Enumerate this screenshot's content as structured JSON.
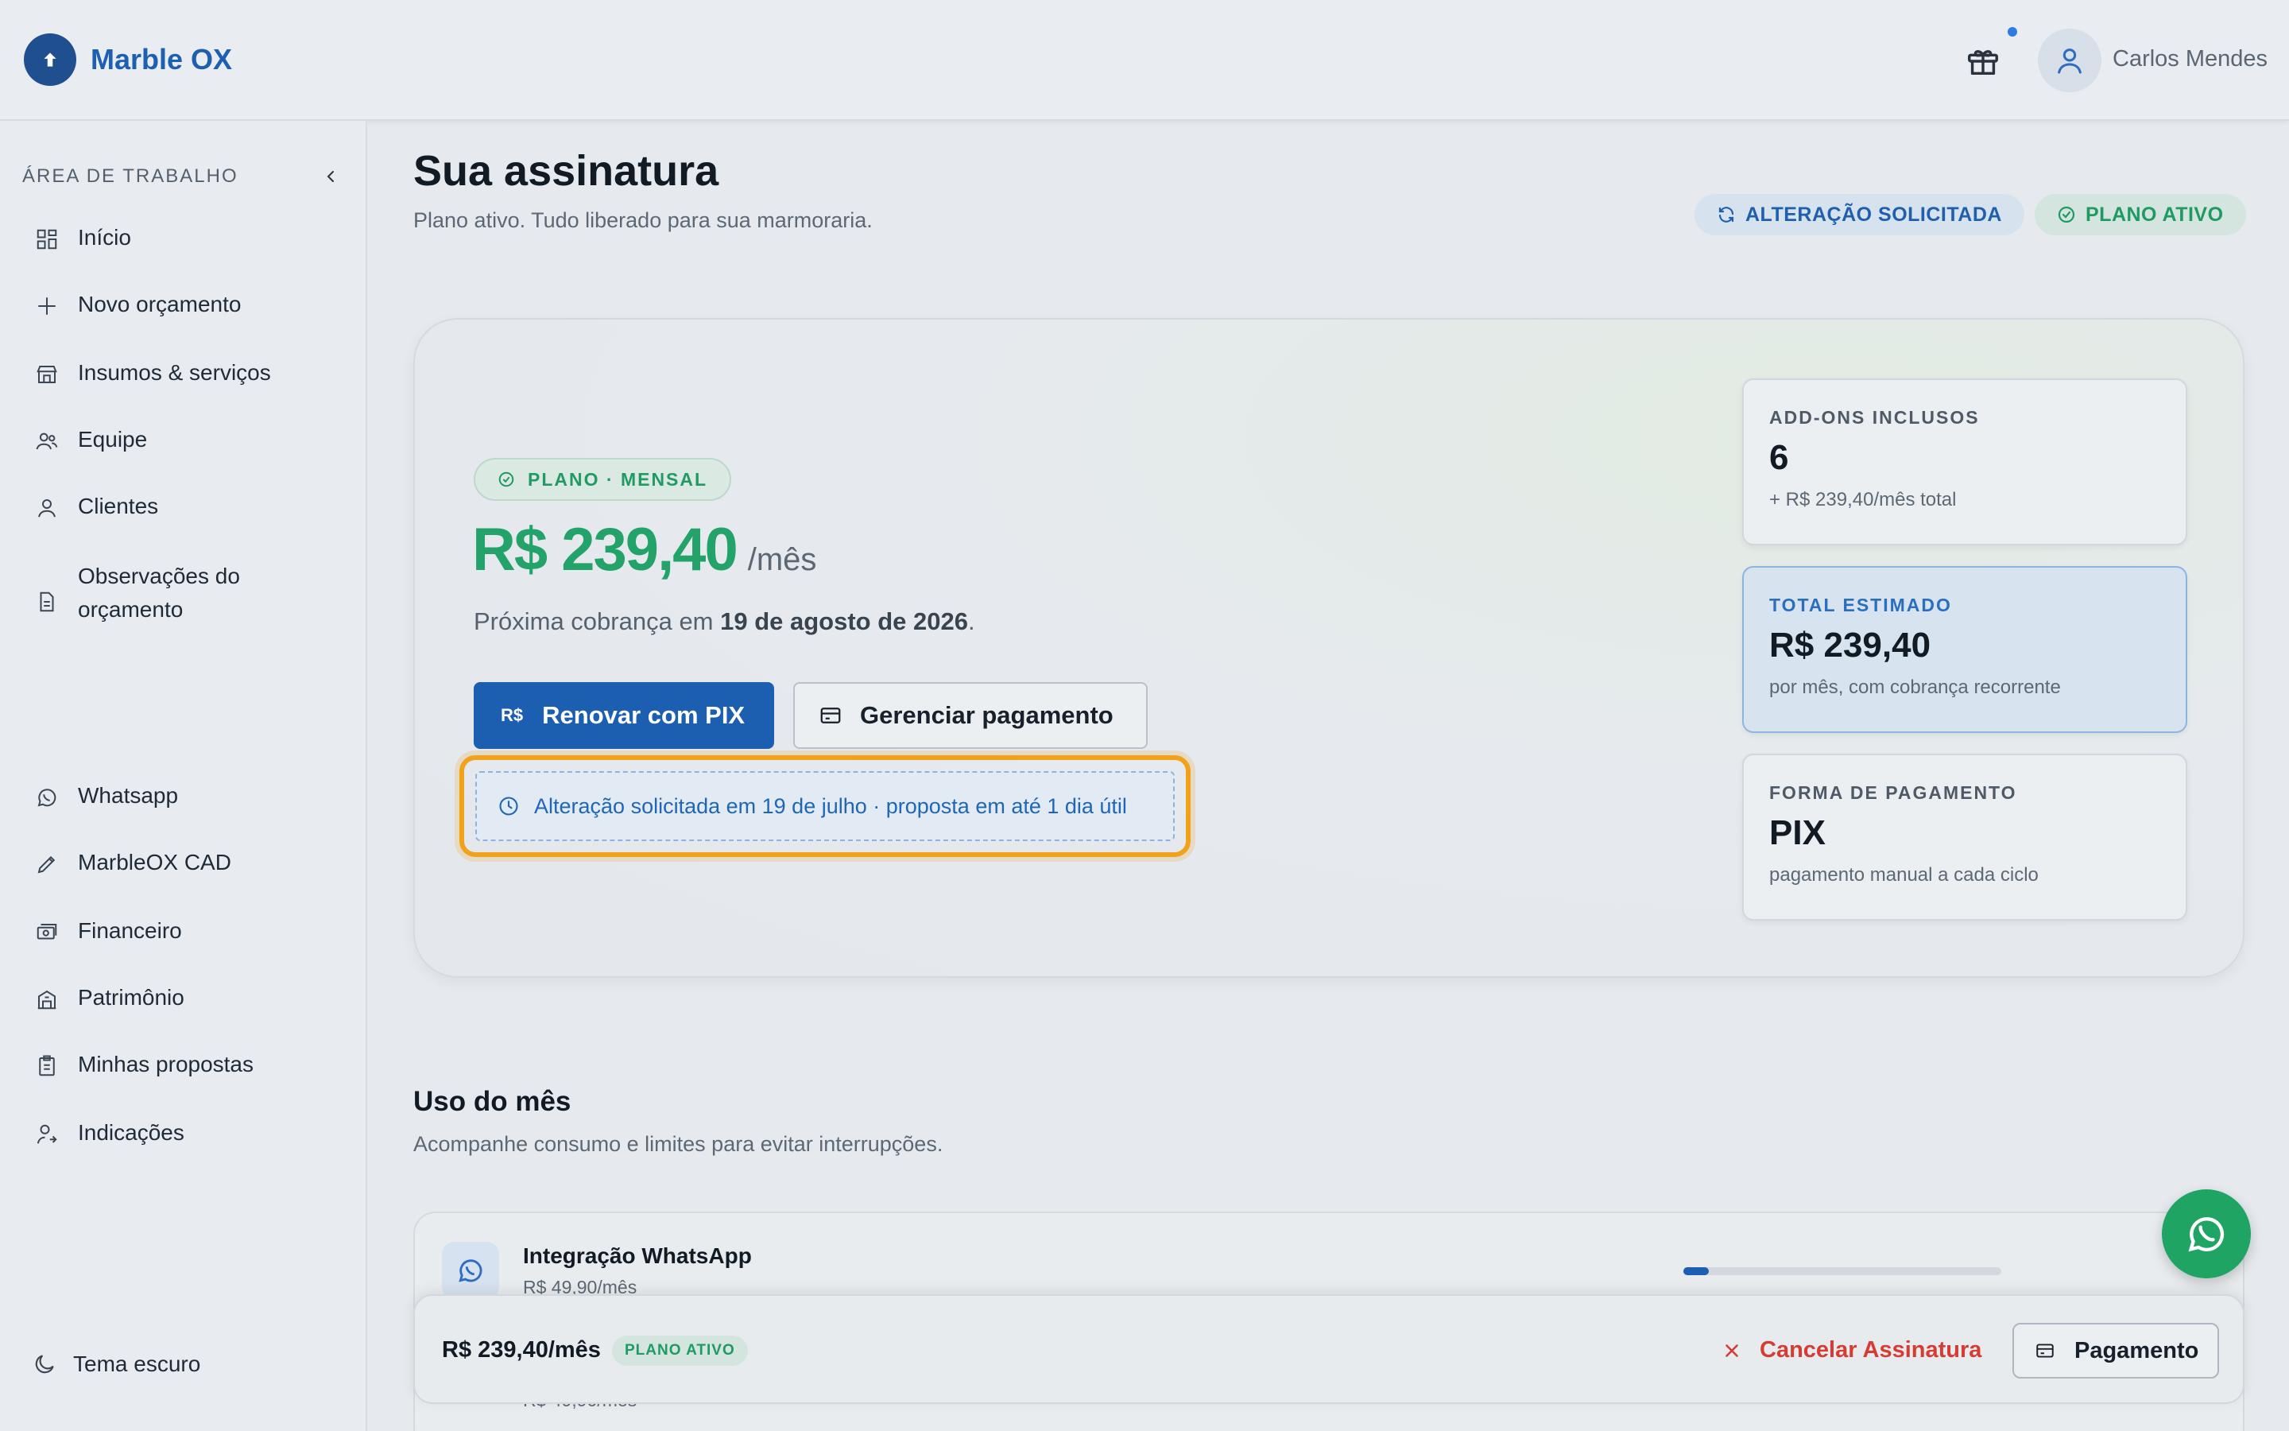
{
  "header": {
    "brand": "Marble OX",
    "user_name": "Carlos Mendes"
  },
  "sidebar": {
    "section_label": "ÁREA DE TRABALHO",
    "items": [
      {
        "label": "Início",
        "icon": "dashboard-icon"
      },
      {
        "label": "Novo orçamento",
        "icon": "plus-icon"
      },
      {
        "label": "Insumos & serviços",
        "icon": "store-icon"
      },
      {
        "label": "Equipe",
        "icon": "users-icon"
      },
      {
        "label": "Clientes",
        "icon": "user-icon"
      },
      {
        "label": "Observações do orçamento",
        "icon": "document-icon"
      },
      {
        "label": "Whatsapp",
        "icon": "whatsapp-icon"
      },
      {
        "label": "MarbleOX CAD",
        "icon": "pencil-icon"
      },
      {
        "label": "Financeiro",
        "icon": "cash-icon"
      },
      {
        "label": "Patrimônio",
        "icon": "building-icon"
      },
      {
        "label": "Minhas propostas",
        "icon": "clipboard-icon"
      },
      {
        "label": "Indicações",
        "icon": "user-share-icon"
      }
    ],
    "theme_toggle": "Tema escuro"
  },
  "page": {
    "title": "Sua assinatura",
    "subtitle": "Plano ativo. Tudo liberado para sua marmoraria.",
    "chip_change": "ALTERAÇÃO SOLICITADA",
    "chip_active": "PLANO ATIVO"
  },
  "plan": {
    "tag": "PLANO · MENSAL",
    "price": "R$ 239,40",
    "per": "/mês",
    "next_charge_prefix": "Próxima cobrança em ",
    "next_charge_date": "19 de agosto de 2026",
    "next_charge_suffix": ".",
    "btn_pix_currency": "R$",
    "btn_pix": "Renovar com PIX",
    "btn_manage": "Gerenciar pagamento",
    "notice": "Alteração solicitada em 19 de julho · proposta em até 1 dia útil"
  },
  "stats": [
    {
      "label": "ADD-ONS INCLUSOS",
      "value": "6",
      "note": "+ R$ 239,40/mês total"
    },
    {
      "label": "TOTAL ESTIMADO",
      "value": "R$ 239,40",
      "note": "por mês, com cobrança recorrente"
    },
    {
      "label": "FORMA DE PAGAMENTO",
      "value": "PIX",
      "note": "pagamento manual a cada ciclo"
    }
  ],
  "usage": {
    "title": "Uso do mês",
    "subtitle": "Acompanhe consumo e limites para evitar interrupções.",
    "items": [
      {
        "name": "Integração WhatsApp",
        "price": "R$ 49,90/mês",
        "progress": 0.08
      },
      {
        "price": "R$ 49,90/mês"
      }
    ]
  },
  "footer": {
    "price": "R$ 239,40/mês",
    "badge": "PLANO ATIVO",
    "cancel": "Cancelar Assinatura",
    "payment": "Pagamento"
  },
  "colors": {
    "brand": "#1d5fb0",
    "primary_button": "#1c5fb0",
    "success": "#23a269",
    "danger": "#d63b34",
    "highlight": "#f0a21a"
  }
}
